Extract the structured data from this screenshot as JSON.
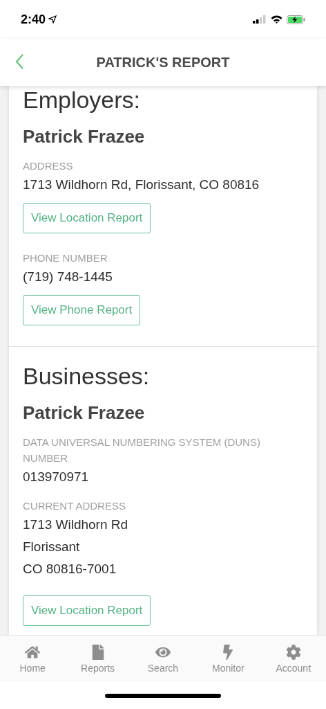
{
  "status_bar": {
    "time": "2:40"
  },
  "header": {
    "title": "PATRICK'S REPORT"
  },
  "sections": [
    {
      "heading": "Employers:",
      "name": "Patrick Frazee",
      "fields": [
        {
          "label": "ADDRESS",
          "lines": [
            "1713 Wildhorn Rd, Florissant, CO 80816"
          ],
          "button": "View Location Report"
        },
        {
          "label": "PHONE NUMBER",
          "lines": [
            "(719) 748-1445"
          ],
          "button": "View Phone Report"
        }
      ]
    },
    {
      "heading": "Businesses:",
      "name": "Patrick Frazee",
      "fields": [
        {
          "label": "DATA UNIVERSAL NUMBERING SYSTEM (DUNS) NUMBER",
          "lines": [
            "013970971"
          ]
        },
        {
          "label": "CURRENT ADDRESS",
          "lines": [
            "1713 Wildhorn Rd",
            "Florissant",
            "CO 80816-7001"
          ],
          "button": "View Location Report"
        }
      ]
    }
  ],
  "tab_bar": [
    {
      "kind": "home",
      "label": "Home"
    },
    {
      "kind": "reports",
      "label": "Reports"
    },
    {
      "kind": "search",
      "label": "Search"
    },
    {
      "kind": "monitor",
      "label": "Monitor"
    },
    {
      "kind": "account",
      "label": "Account"
    }
  ]
}
